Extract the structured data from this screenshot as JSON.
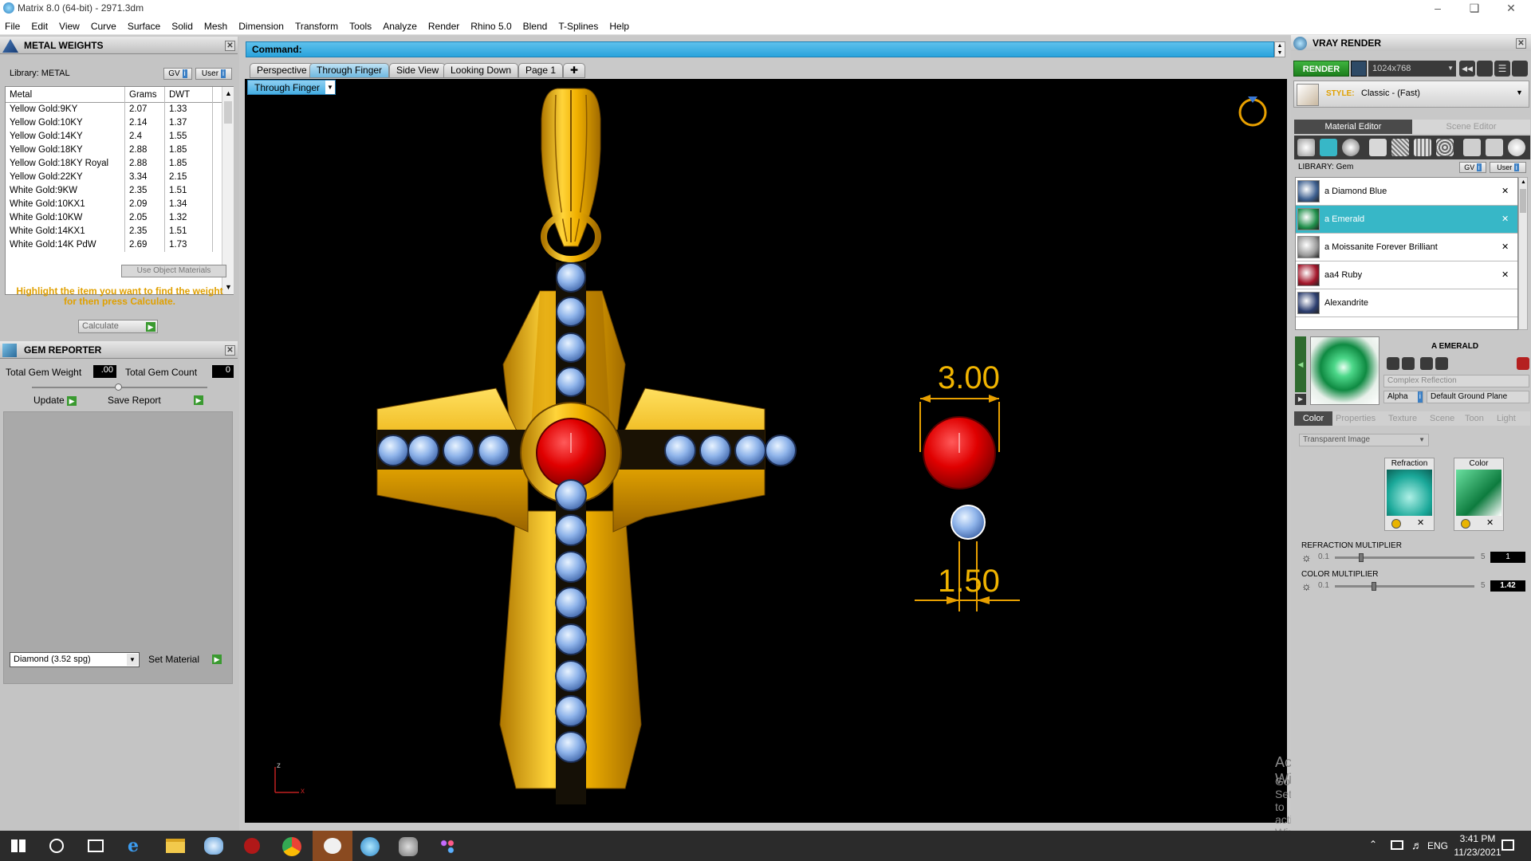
{
  "window": {
    "title": "Matrix 8.0 (64-bit) - 2971.3dm"
  },
  "menu": [
    "File",
    "Edit",
    "View",
    "Curve",
    "Surface",
    "Solid",
    "Mesh",
    "Dimension",
    "Transform",
    "Tools",
    "Analyze",
    "Render",
    "Rhino 5.0",
    "Blend",
    "T-Splines",
    "Help"
  ],
  "metal_weights": {
    "title": "METAL WEIGHTS",
    "library_label": "Library: METAL",
    "gv": "GV",
    "user": "User",
    "columns": [
      "Metal",
      "Grams",
      "DWT"
    ],
    "rows": [
      [
        "Yellow Gold:9KY",
        "2.07",
        "1.33"
      ],
      [
        "Yellow Gold:10KY",
        "2.14",
        "1.37"
      ],
      [
        "Yellow Gold:14KY",
        "2.4",
        "1.55"
      ],
      [
        "Yellow Gold:18KY",
        "2.88",
        "1.85"
      ],
      [
        "Yellow Gold:18KY Royal",
        "2.88",
        "1.85"
      ],
      [
        "Yellow Gold:22KY",
        "3.34",
        "2.15"
      ],
      [
        "White Gold:9KW",
        "2.35",
        "1.51"
      ],
      [
        "White Gold:10KX1",
        "2.09",
        "1.34"
      ],
      [
        "White Gold:10KW",
        "2.05",
        "1.32"
      ],
      [
        "White Gold:14KX1",
        "2.35",
        "1.51"
      ],
      [
        "White Gold:14K PdW",
        "2.69",
        "1.73"
      ]
    ],
    "use_object_materials": "Use Object Materials",
    "hint": "Highlight the item you want to find the weight for then press Calculate.",
    "calculate": "Calculate"
  },
  "gem_reporter": {
    "title": "GEM REPORTER",
    "total_weight_label": "Total Gem Weight",
    "total_weight_value": ".00",
    "total_count_label": "Total Gem Count",
    "total_count_value": "0",
    "update": "Update",
    "save_report": "Save Report",
    "material_select": "Diamond    (3.52 spg)",
    "set_material": "Set Material"
  },
  "command": {
    "label": "Command:"
  },
  "view_tabs": [
    "Perspective",
    "Through Finger",
    "Side View",
    "Looking Down",
    "Page 1"
  ],
  "active_view_tab": "Through Finger",
  "view_dropdown": "Through Finger",
  "viewport": {
    "dimension_top": "3.00",
    "dimension_bottom": "1.50",
    "axis_z": "z",
    "axis_x": "x",
    "watermark_title": "Activate Windows",
    "watermark_sub": "Go to Settings to activate Windows."
  },
  "vray": {
    "title": "VRAY RENDER",
    "render_btn": "RENDER",
    "resolution": "1024x768",
    "style_label": "STYLE:",
    "style_value": "Classic - (Fast)",
    "tab_material": "Material Editor",
    "tab_scene": "Scene Editor",
    "library_label": "LIBRARY: Gem",
    "gv": "GV",
    "user": "User",
    "gems": [
      {
        "name": "a Diamond Blue",
        "color": "#3d5f8f"
      },
      {
        "name": "a Emerald",
        "color": "#1f8f4a"
      },
      {
        "name": "a Moissanite Forever Brilliant",
        "color": "#9a9a9a"
      },
      {
        "name": "aa4 Ruby",
        "color": "#a3162a"
      },
      {
        "name": "Alexandrite",
        "color": "#2d3f70"
      }
    ],
    "selected_gem": "a Emerald",
    "preview_name": "A EMERALD",
    "reflection": "Complex Reflection",
    "alpha": "Alpha",
    "ground": "Default Ground Plane",
    "sub_tabs": [
      "Color",
      "Properties",
      "Texture",
      "Scene",
      "Toon",
      "Light"
    ],
    "image_mode": "Transparent Image",
    "refraction_label": "Refraction",
    "color_label": "Color",
    "refraction_multiplier_label": "REFRACTION MULTIPLIER",
    "refraction_min": "0.1",
    "refraction_max": "5",
    "refraction_value": "1",
    "color_multiplier_label": "COLOR MULTIPLIER",
    "color_min": "0.1",
    "color_max": "5",
    "color_value": "1.42"
  },
  "taskbar": {
    "time": "3:41 PM",
    "date": "11/23/2021",
    "lang": "ENG"
  },
  "colors": {
    "gold": "#f0b400",
    "ruby": "#e01010",
    "accent": "#37b7c7"
  }
}
